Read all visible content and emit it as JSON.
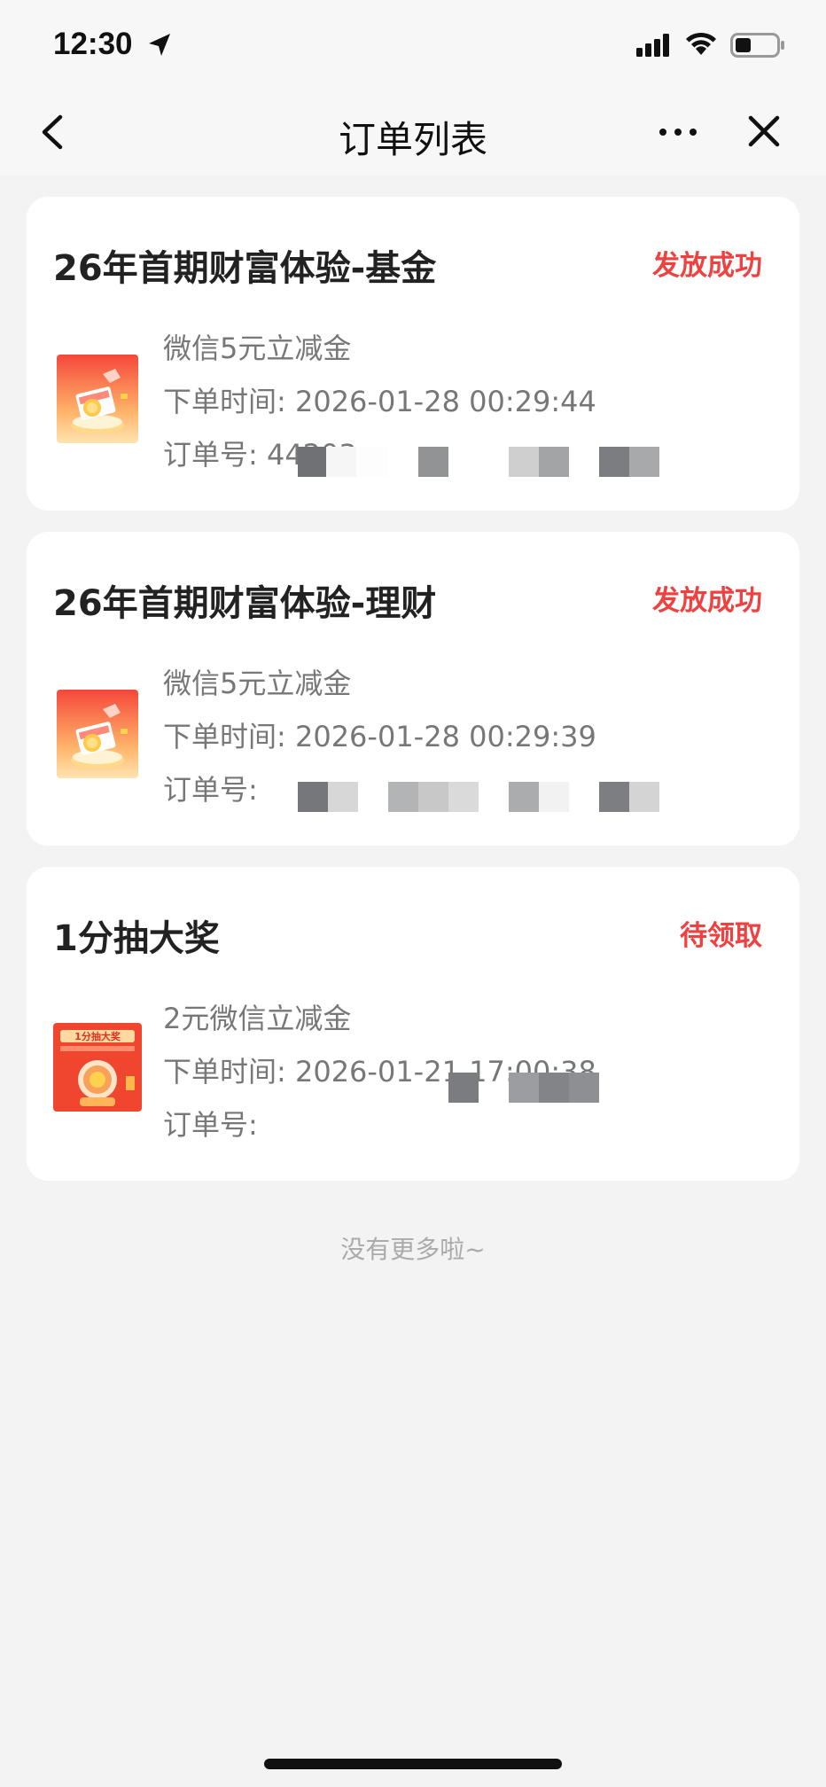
{
  "status_bar": {
    "time": "12:30"
  },
  "nav": {
    "title": "订单列表"
  },
  "orders": [
    {
      "title": "26年首期财富体验-基金",
      "status": "发放成功",
      "product": "微信5元立减金",
      "time_label": "下单时间: ",
      "time": "2026-01-28 00:29:44",
      "order_no_label": "订单号: ",
      "order_no_visible": "44203"
    },
    {
      "title": "26年首期财富体验-理财",
      "status": "发放成功",
      "product": "微信5元立减金",
      "time_label": "下单时间: ",
      "time": "2026-01-28 00:29:39",
      "order_no_label": "订单号: ",
      "order_no_visible": ""
    },
    {
      "title": "1分抽大奖",
      "status": "待领取",
      "product": "2元微信立减金",
      "time_label": "下单时间: ",
      "time": "2026-01-21 17:00:38",
      "order_no_label": "订单号: ",
      "order_no_visible": ""
    }
  ],
  "thumb_text": "1分抽大奖",
  "footer": {
    "no_more": "没有更多啦~"
  },
  "colors": {
    "status_red": "#f04141",
    "background": "#f3f3f3",
    "card": "#ffffff"
  }
}
